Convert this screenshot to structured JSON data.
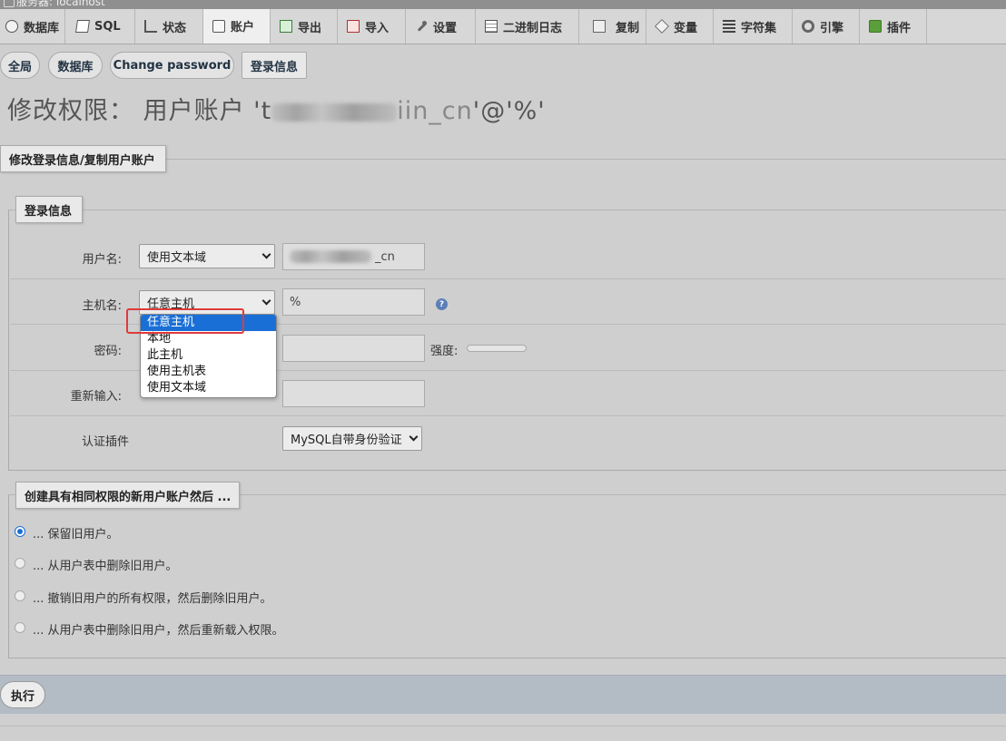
{
  "server": {
    "label": "服务器: localhost"
  },
  "topnav": [
    {
      "label": "数据库",
      "icon": "database-icon"
    },
    {
      "label": "SQL",
      "icon": "sql-icon"
    },
    {
      "label": "状态",
      "icon": "status-icon"
    },
    {
      "label": "账户",
      "icon": "accounts-icon",
      "active": true
    },
    {
      "label": "导出",
      "icon": "export-icon"
    },
    {
      "label": "导入",
      "icon": "import-icon"
    },
    {
      "label": "设置",
      "icon": "wrench-icon"
    },
    {
      "label": "二进制日志",
      "icon": "binlog-icon"
    },
    {
      "label": "复制",
      "icon": "replication-icon"
    },
    {
      "label": "变量",
      "icon": "variables-icon"
    },
    {
      "label": "字符集",
      "icon": "charset-icon"
    },
    {
      "label": "引擎",
      "icon": "engine-icon"
    },
    {
      "label": "插件",
      "icon": "plugin-icon"
    }
  ],
  "subnav": [
    "全局",
    "数据库",
    "Change password",
    "登录信息"
  ],
  "page_title": {
    "prefix": "修改权限：  用户账户 '",
    "frag1": "t",
    "frag2": "iin_cn",
    "suffix": "'@'%'"
  },
  "section_legend": "修改登录信息/复制用户账户",
  "login_legend": "登录信息",
  "form": {
    "username_label": "用户名:",
    "username_select": "使用文本域",
    "username_value": "_cn",
    "host_label": "主机名:",
    "host_select": "任意主机",
    "host_value": "%",
    "help_icon_text": "?",
    "password_label": "密码:",
    "strength_label": "强度:",
    "retype_label": "重新输入:",
    "auth_label": "认证插件",
    "auth_select": "MySQL自带身份验证"
  },
  "host_dropdown": {
    "options": [
      "任意主机",
      "本地",
      "此主机",
      "使用主机表",
      "使用文本域"
    ],
    "selected": "任意主机"
  },
  "create_legend": "创建具有相同权限的新用户账户然后 ...",
  "radio_options": [
    {
      "label": "... 保留旧用户。",
      "checked": true
    },
    {
      "label": "... 从用户表中删除旧用户。",
      "checked": false
    },
    {
      "label": "... 撤销旧用户的所有权限，然后删除旧用户。",
      "checked": false
    },
    {
      "label": "... 从用户表中删除旧用户，然后重新载入权限。",
      "checked": false
    }
  ],
  "execute_label": "执行",
  "colors": {
    "accent": "#1a6fd6",
    "highlight": "#e03a3a"
  }
}
